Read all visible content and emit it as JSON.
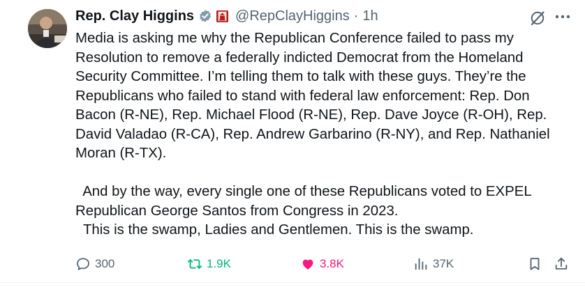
{
  "author": {
    "name": "Rep. Clay Higgins",
    "handle": "@RepClayHiggins",
    "time": "1h",
    "separator": "·"
  },
  "tweet": {
    "paragraph1": "Media is asking me why the Republican Conference failed to pass my\nResolution to remove a federally indicted Democrat from the Homeland\nSecurity Committee. I’m telling them to talk with these guys. They’re the\nRepublicans who failed to stand with federal law enforcement: Rep. Don\nBacon (R-NE), Rep. Michael Flood (R-NE), Rep. Dave Joyce (R-OH), Rep.\nDavid Valadao (R-CA), Rep. Andrew Garbarino (R-NY), and Rep. Nathaniel\nMoran (R-TX).",
    "paragraph2_line1": "  And by the way, every single one of these Republicans voted to EXPEL",
    "paragraph2_line2": "Republican George Santos from Congress in 2023.",
    "paragraph2_line3": "  This is the swamp, Ladies and Gentlemen. This is the swamp."
  },
  "actions": {
    "replies": "300",
    "reposts": "1.9K",
    "likes": "3.8K",
    "views": "37K"
  },
  "colors": {
    "text": "#0f1419",
    "muted": "#536471",
    "verified": "#829aab",
    "repost_active": "#00ba7c",
    "like_active": "#f91880"
  },
  "icons": [
    "verified-badge-icon",
    "government-affiliation-icon",
    "grok-icon",
    "more-icon",
    "reply-icon",
    "repost-icon",
    "like-icon",
    "views-icon",
    "bookmark-icon",
    "share-icon"
  ]
}
